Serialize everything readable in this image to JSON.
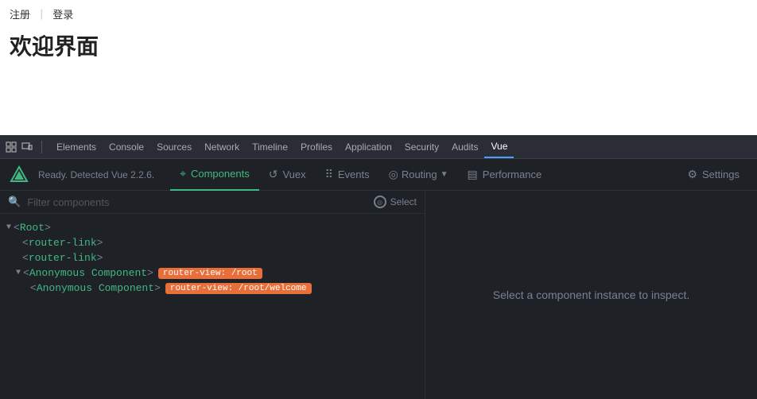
{
  "page": {
    "links": {
      "register": "注册",
      "divider": "｜",
      "login": "登录"
    },
    "title": "欢迎界面"
  },
  "browser_devtools": {
    "tabs": [
      {
        "label": "Elements",
        "active": false
      },
      {
        "label": "Console",
        "active": false
      },
      {
        "label": "Sources",
        "active": false
      },
      {
        "label": "Network",
        "active": false
      },
      {
        "label": "Timeline",
        "active": false
      },
      {
        "label": "Profiles",
        "active": false
      },
      {
        "label": "Application",
        "active": false
      },
      {
        "label": "Security",
        "active": false
      },
      {
        "label": "Audits",
        "active": false
      },
      {
        "label": "Vue",
        "active": true
      }
    ]
  },
  "vue_devtools": {
    "status": "Ready. Detected Vue 2.2.6.",
    "tabs": [
      {
        "label": "Components",
        "icon": "⌖",
        "active": true
      },
      {
        "label": "Vuex",
        "icon": "↺"
      },
      {
        "label": "Events",
        "icon": "⠿"
      },
      {
        "label": "Routing",
        "icon": "◎",
        "dropdown": true
      },
      {
        "label": "Performance",
        "icon": "▤"
      },
      {
        "label": "Settings",
        "icon": "⚙",
        "right": true
      }
    ]
  },
  "filter": {
    "placeholder": "Filter components",
    "select_label": "Select"
  },
  "tree": {
    "rows": [
      {
        "indent": 0,
        "arrow": "▼",
        "tag": "Root",
        "closing": false,
        "badge": null
      },
      {
        "indent": 1,
        "arrow": null,
        "tag": "router-link",
        "closing": false,
        "badge": null
      },
      {
        "indent": 1,
        "arrow": null,
        "tag": "router-link",
        "closing": false,
        "badge": null
      },
      {
        "indent": 1,
        "arrow": "▼",
        "tag": "Anonymous Component",
        "closing": false,
        "badge": "router-view: /root"
      },
      {
        "indent": 2,
        "arrow": null,
        "tag": "Anonymous Component",
        "closing": false,
        "badge": "router-view: /root/welcome"
      }
    ]
  },
  "inspect_panel": {
    "message": "Select a component instance to inspect."
  }
}
